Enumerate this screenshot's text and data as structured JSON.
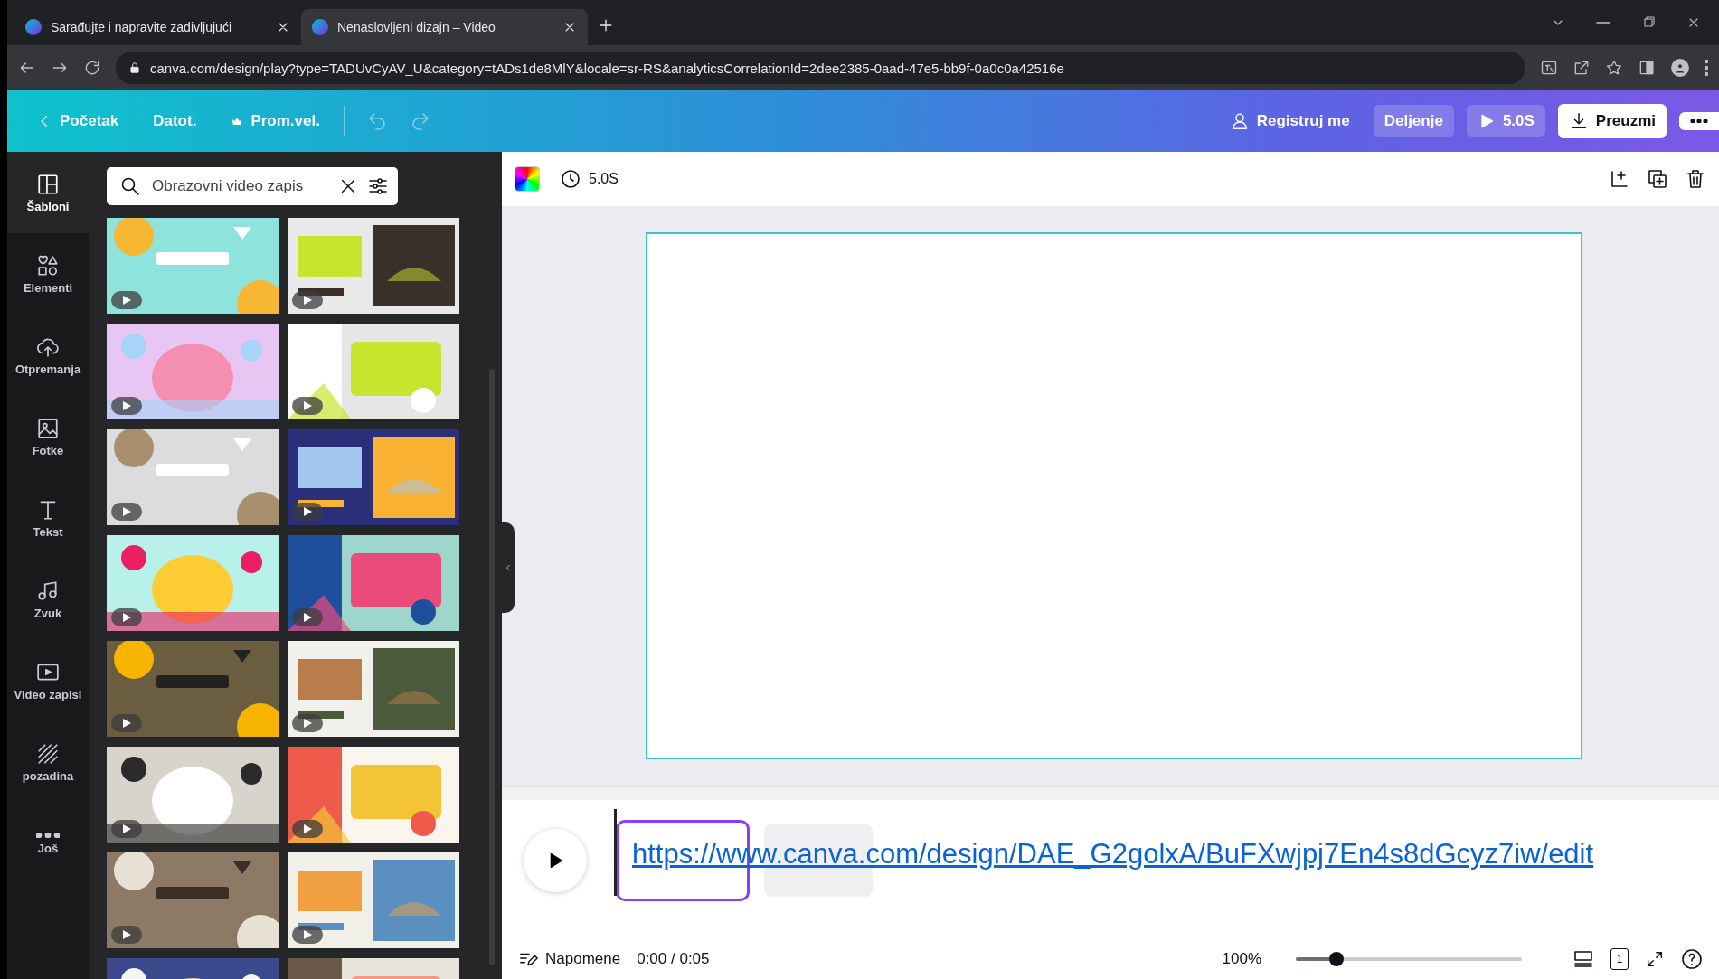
{
  "browser": {
    "tabs": [
      {
        "title": "Sarađujte i napravite zadivljujući",
        "selected": false
      },
      {
        "title": "Nenaslovljeni dizajn – Video",
        "selected": true
      }
    ],
    "address": "canva.com/design/play?type=TADUvCyAV_U&category=tADs1de8MlY&locale=sr-RS&analyticsCorrelationId=2dee2385-0aad-47e5-bb9f-0a0c0a42516e"
  },
  "header": {
    "back": "Početak",
    "file": "Datot.",
    "resize": "Prom.vel.",
    "register": "Registruj me",
    "share": "Deljenje",
    "play": "5.0S",
    "download": "Preuzmi"
  },
  "rail": [
    {
      "kind": "templates",
      "label": "Šabloni",
      "selected": true
    },
    {
      "kind": "elements",
      "label": "Elementi",
      "selected": false
    },
    {
      "kind": "uploads",
      "label": "Otpremanja",
      "selected": false
    },
    {
      "kind": "photos",
      "label": "Fotke",
      "selected": false
    },
    {
      "kind": "text",
      "label": "Tekst",
      "selected": false
    },
    {
      "kind": "audio",
      "label": "Zvuk",
      "selected": false
    },
    {
      "kind": "video",
      "label": "Video zapisi",
      "selected": false
    },
    {
      "kind": "background",
      "label": "pozadina",
      "selected": false
    },
    {
      "kind": "more",
      "label": "Još",
      "selected": false
    }
  ],
  "search": {
    "value": "Obrazovni video zapis"
  },
  "templates": [
    {
      "kind": "video"
    },
    {
      "kind": "video"
    },
    {
      "kind": "video"
    },
    {
      "kind": "video"
    },
    {
      "kind": "video"
    },
    {
      "kind": "video"
    },
    {
      "kind": "video"
    },
    {
      "kind": "video"
    },
    {
      "kind": "video"
    },
    {
      "kind": "video"
    },
    {
      "kind": "video"
    },
    {
      "kind": "video"
    },
    {
      "kind": "video"
    },
    {
      "kind": "video"
    },
    {
      "kind": "picture"
    },
    {
      "kind": "picture"
    }
  ],
  "toolbar": {
    "duration": "5.0S"
  },
  "timeline": {
    "link": "https://www.canva.com/design/DAE_G2golxA/BuFXwjpj7En4s8dGcyz7iw/edit"
  },
  "footer": {
    "notes": "Napomene",
    "time": "0:00 / 0:05",
    "zoom": "100%",
    "level": 0.18,
    "pages": "1"
  }
}
